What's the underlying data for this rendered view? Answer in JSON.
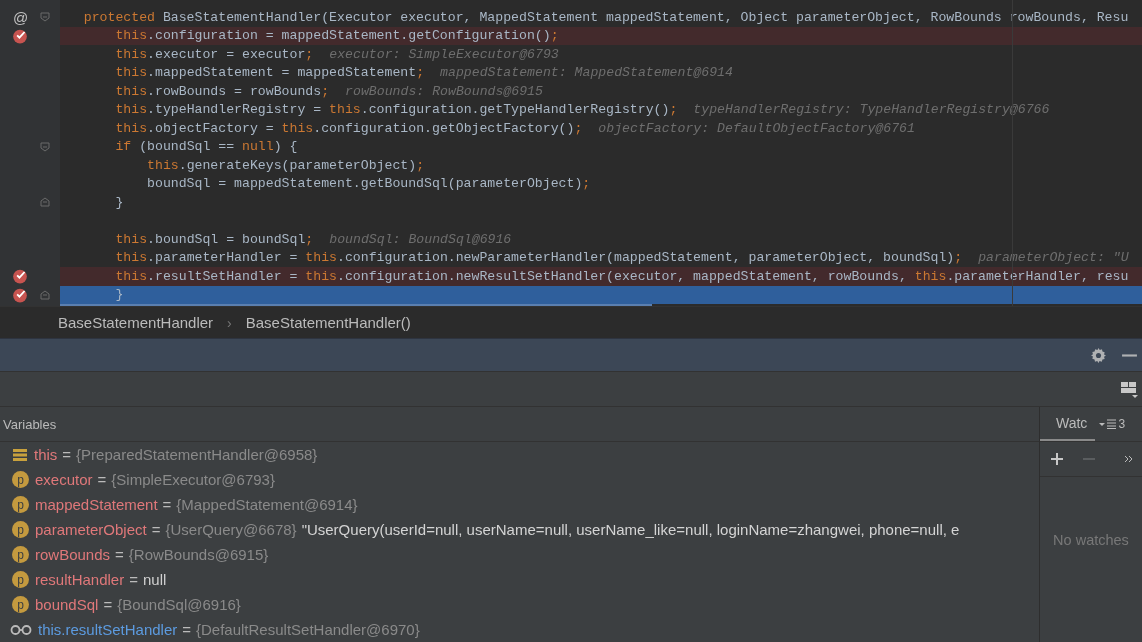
{
  "editor": {
    "lines": [
      {
        "gutter_mark": "@",
        "fold_start": true,
        "segments": [
          {
            "kind": "kw",
            "text": "   protected"
          },
          {
            "kind": "code",
            "text": " BaseStatementHandler(Executor executor, MappedStatement mappedStatement, Object parameterObject, RowBounds rowBounds, Resu"
          }
        ]
      },
      {
        "breakpoint": true,
        "segments": [
          {
            "kind": "kw",
            "text": "       this"
          },
          {
            "kind": "code",
            "text": ".configuration = mappedStatement.getConfiguration()"
          },
          {
            "kind": "kw",
            "text": ";"
          }
        ]
      },
      {
        "segments": [
          {
            "kind": "kw",
            "text": "       this"
          },
          {
            "kind": "code",
            "text": ".executor = executor"
          },
          {
            "kind": "kw",
            "text": ";"
          },
          {
            "kind": "hint",
            "text": "executor: SimpleExecutor@6793"
          }
        ]
      },
      {
        "segments": [
          {
            "kind": "kw",
            "text": "       this"
          },
          {
            "kind": "code",
            "text": ".mappedStatement = mappedStatement"
          },
          {
            "kind": "kw",
            "text": ";"
          },
          {
            "kind": "hint",
            "text": "mappedStatement: MappedStatement@6914"
          }
        ]
      },
      {
        "segments": [
          {
            "kind": "kw",
            "text": "       this"
          },
          {
            "kind": "code",
            "text": ".rowBounds = rowBounds"
          },
          {
            "kind": "kw",
            "text": ";"
          },
          {
            "kind": "hint",
            "text": "rowBounds: RowBounds@6915"
          }
        ]
      },
      {
        "segments": [
          {
            "kind": "kw",
            "text": "       this"
          },
          {
            "kind": "code",
            "text": ".typeHandlerRegistry = "
          },
          {
            "kind": "kw",
            "text": "this"
          },
          {
            "kind": "code",
            "text": ".configuration.getTypeHandlerRegistry()"
          },
          {
            "kind": "kw",
            "text": ";"
          },
          {
            "kind": "hint",
            "text": "typeHandlerRegistry: TypeHandlerRegistry@6766"
          }
        ]
      },
      {
        "segments": [
          {
            "kind": "kw",
            "text": "       this"
          },
          {
            "kind": "code",
            "text": ".objectFactory = "
          },
          {
            "kind": "kw",
            "text": "this"
          },
          {
            "kind": "code",
            "text": ".configuration.getObjectFactory()"
          },
          {
            "kind": "kw",
            "text": ";"
          },
          {
            "kind": "hint",
            "text": "objectFactory: DefaultObjectFactory@6761"
          }
        ]
      },
      {
        "fold_start": true,
        "segments": [
          {
            "kind": "kw",
            "text": "       if"
          },
          {
            "kind": "code",
            "text": " (boundSql == "
          },
          {
            "kind": "kw",
            "text": "null"
          },
          {
            "kind": "code",
            "text": ") {"
          }
        ]
      },
      {
        "segments": [
          {
            "kind": "kw",
            "text": "           this"
          },
          {
            "kind": "code",
            "text": ".generateKeys(parameterObject)"
          },
          {
            "kind": "kw",
            "text": ";"
          }
        ]
      },
      {
        "segments": [
          {
            "kind": "code",
            "text": "           boundSql = mappedStatement.getBoundSql(parameterObject)"
          },
          {
            "kind": "kw",
            "text": ";"
          }
        ]
      },
      {
        "fold_end": true,
        "segments": [
          {
            "kind": "code",
            "text": "       }"
          }
        ]
      },
      {
        "blank": true
      },
      {
        "segments": [
          {
            "kind": "kw",
            "text": "       this"
          },
          {
            "kind": "code",
            "text": ".boundSql = boundSql"
          },
          {
            "kind": "kw",
            "text": ";"
          },
          {
            "kind": "hint",
            "text": "boundSql: BoundSql@6916"
          }
        ]
      },
      {
        "segments": [
          {
            "kind": "kw",
            "text": "       this"
          },
          {
            "kind": "code",
            "text": ".parameterHandler = "
          },
          {
            "kind": "kw",
            "text": "this"
          },
          {
            "kind": "code",
            "text": ".configuration.newParameterHandler(mappedStatement, parameterObject, boundSql)"
          },
          {
            "kind": "kw",
            "text": ";"
          },
          {
            "kind": "hint",
            "text": "parameterObject: \"U"
          }
        ]
      },
      {
        "breakpoint": true,
        "segments": [
          {
            "kind": "kw",
            "text": "       this"
          },
          {
            "kind": "code",
            "text": ".resultSetHandler = "
          },
          {
            "kind": "kw",
            "text": "this"
          },
          {
            "kind": "code",
            "text": ".configuration.newResultSetHandler(executor, mappedStatement, rowBounds, "
          },
          {
            "kind": "kw",
            "text": "this"
          },
          {
            "kind": "code",
            "text": ".parameterHandler, resu"
          }
        ]
      },
      {
        "breakpoint": true,
        "current": true,
        "fold_end": true,
        "segments": [
          {
            "kind": "code",
            "text": "       }"
          }
        ]
      }
    ]
  },
  "breadcrumbs": {
    "items": [
      "BaseStatementHandler",
      "BaseStatementHandler()"
    ],
    "separator": "›"
  },
  "variables": {
    "title": "Variables",
    "items": [
      {
        "kind": "field",
        "name": "this",
        "eq": "=",
        "value": "{PreparedStatementHandler@6958}"
      },
      {
        "kind": "param",
        "badge": "p",
        "name": "executor",
        "eq": "=",
        "value": "{SimpleExecutor@6793}"
      },
      {
        "kind": "param",
        "badge": "p",
        "name": "mappedStatement",
        "eq": "=",
        "value": "{MappedStatement@6914}"
      },
      {
        "kind": "param",
        "badge": "p",
        "name": "parameterObject",
        "eq": "=",
        "value": "{UserQuery@6678}",
        "detail": "\"UserQuery(userId=null, userName=null, userName_like=null, loginName=zhangwei, phone=null, e"
      },
      {
        "kind": "param",
        "badge": "p",
        "name": "rowBounds",
        "eq": "=",
        "value": "{RowBounds@6915}"
      },
      {
        "kind": "param",
        "badge": "p",
        "name": "resultHandler",
        "eq": "=",
        "value": "null",
        "plain": true
      },
      {
        "kind": "param",
        "badge": "p",
        "name": "boundSql",
        "eq": "=",
        "value": "{BoundSql@6916}"
      },
      {
        "kind": "watch",
        "name": "this.resultSetHandler",
        "eq": "=",
        "value": "{DefaultResultSetHandler@6970}"
      }
    ]
  },
  "watches": {
    "tab": "Watc",
    "count": "3",
    "empty_text": "No watches"
  }
}
